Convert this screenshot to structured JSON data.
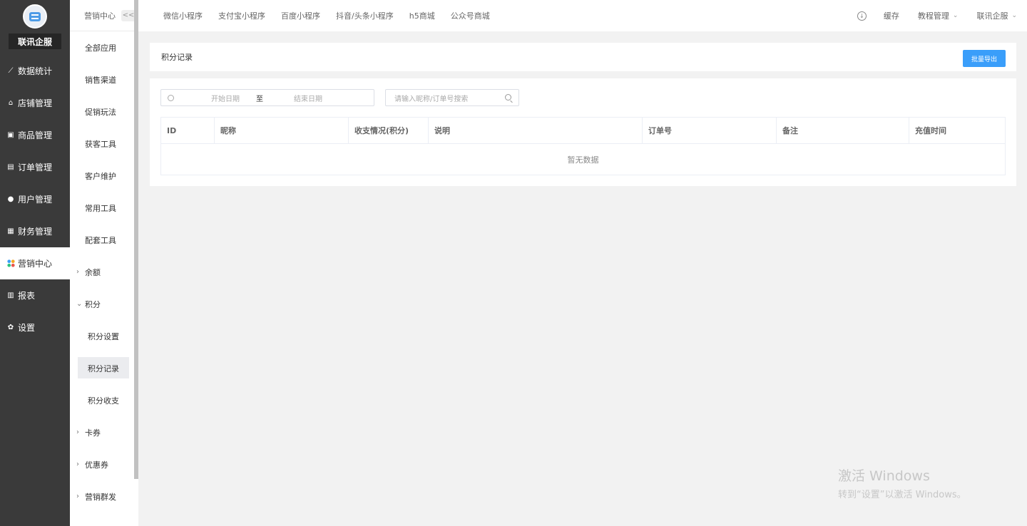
{
  "sidebar": {
    "brand": "联讯企服",
    "items": [
      {
        "label": "数据统计",
        "icon": "chart-line-icon"
      },
      {
        "label": "店铺管理",
        "icon": "store-icon"
      },
      {
        "label": "商品管理",
        "icon": "box-icon"
      },
      {
        "label": "订单管理",
        "icon": "order-icon"
      },
      {
        "label": "用户管理",
        "icon": "user-icon"
      },
      {
        "label": "财务管理",
        "icon": "wallet-icon"
      },
      {
        "label": "营销中心",
        "icon": "marketing-icon",
        "active": true
      },
      {
        "label": "报表",
        "icon": "report-icon"
      },
      {
        "label": "设置",
        "icon": "gear-icon"
      }
    ]
  },
  "subnav": {
    "header": "营销中心",
    "collapse": "<<",
    "items": [
      "全部应用",
      "销售渠道",
      "促销玩法",
      "获客工具",
      "客户维护",
      "常用工具",
      "配套工具"
    ],
    "balance": "余额",
    "points": "积分",
    "points_children": [
      "积分设置",
      "积分记录",
      "积分收支"
    ],
    "after": [
      "卡券",
      "优惠券",
      "营销群发"
    ]
  },
  "topbar": {
    "tabs": [
      "微信小程序",
      "支付宝小程序",
      "百度小程序",
      "抖音/头条小程序",
      "h5商城",
      "公众号商城"
    ],
    "cache": "缓存",
    "tutorial": "教程管理",
    "account": "联讯企服"
  },
  "page": {
    "title": "积分记录",
    "export_label": "批量导出"
  },
  "filters": {
    "start_placeholder": "开始日期",
    "separator": "至",
    "end_placeholder": "结束日期",
    "search_placeholder": "请输入昵称/订单号搜索"
  },
  "table": {
    "columns": [
      "ID",
      "昵称",
      "收支情况(积分)",
      "说明",
      "订单号",
      "备注",
      "充值时间"
    ],
    "empty_text": "暂无数据"
  },
  "watermark": {
    "line1": "激活 Windows",
    "line2": "转到“设置”以激活 Windows。"
  },
  "colors": {
    "sidebar_bg": "#3a3a3a",
    "primary": "#3a9efa",
    "page_bg": "#f2f2f2"
  }
}
